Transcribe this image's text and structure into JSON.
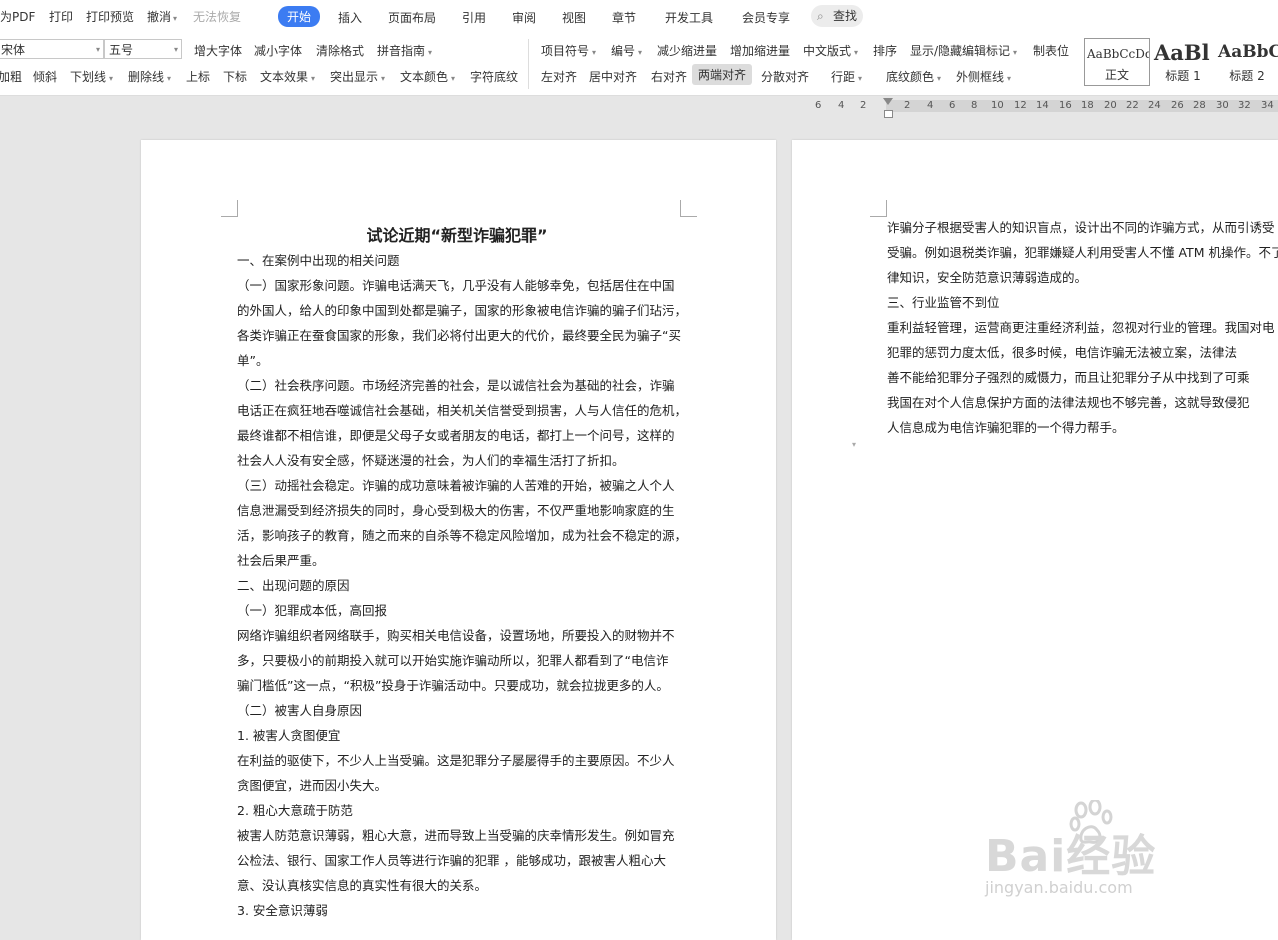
{
  "menubar": {
    "left_items": [
      "为PDF",
      "打印",
      "打印预览",
      "撤消",
      "无法恢复"
    ],
    "tabs": [
      "开始",
      "插入",
      "页面布局",
      "引用",
      "审阅",
      "视图",
      "章节",
      "开发工具",
      "会员专享"
    ],
    "active_tab": "开始",
    "search_label": "查找"
  },
  "toolbar": {
    "font_name": "宋体",
    "font_size": "五号",
    "row1_left": [
      "增大字体",
      "减小字体",
      "清除格式",
      "拼音指南"
    ],
    "row2_left": [
      "加粗",
      "倾斜",
      "下划线",
      "删除线",
      "上标",
      "下标",
      "文本效果",
      "突出显示",
      "文本颜色",
      "字符底纹"
    ],
    "row1_para": [
      "项目符号",
      "编号",
      "减少缩进量",
      "增加缩进量",
      "中文版式",
      "排序",
      "显示/隐藏编辑标记",
      "制表位"
    ],
    "row2_para": [
      "左对齐",
      "居中对齐",
      "右对齐",
      "两端对齐",
      "分散对齐",
      "行距",
      "底纹颜色",
      "外侧框线"
    ],
    "styles": [
      {
        "preview": "AaBbCcDd",
        "name": "正文"
      },
      {
        "preview": "AaBl",
        "name": "标题 1"
      },
      {
        "preview": "AaBbC",
        "name": "标题 2"
      }
    ]
  },
  "ruler": {
    "numbers": [
      "6",
      "4",
      "2",
      "2",
      "4",
      "6",
      "8",
      "10",
      "12",
      "14",
      "16",
      "18",
      "20",
      "22",
      "24",
      "26",
      "28",
      "30",
      "32",
      "34"
    ]
  },
  "document": {
    "title": "试论近期“新型诈骗犯罪”",
    "page1_lines": [
      "一、在案例中出现的相关问题",
      "（一）国家形象问题。诈骗电话满天飞，几乎没有人能够幸免，包括居住在中国",
      "的外国人，给人的印象中国到处都是骗子，国家的形象被电信诈骗的骗子们玷污，",
      "各类诈骗正在蚕食国家的形象，我们必将付出更大的代价，最终要全民为骗子“买",
      "单”。",
      "（二）社会秩序问题。市场经济完善的社会，是以诚信社会为基础的社会，诈骗",
      "电话正在疯狂地吞噬诚信社会基础，相关机关信誉受到损害，人与人信任的危机，",
      "最终谁都不相信谁，即便是父母子女或者朋友的电话，都打上一个问号，这样的",
      "社会人人没有安全感，怀疑迷漫的社会，为人们的幸福生活打了折扣。",
      "（三）动摇社会稳定。诈骗的成功意味着被诈骗的人苦难的开始，被骗之人个人",
      "信息泄漏受到经济损失的同时，身心受到极大的伤害，不仅严重地影响家庭的生",
      "活，影响孩子的教育，随之而来的自杀等不稳定风险增加，成为社会不稳定的源，",
      "社会后果严重。",
      "二、出现问题的原因",
      "（一）犯罪成本低，高回报",
      "网络诈骗组织者网络联手，购买相关电信设备，设置场地，所要投入的财物并不",
      "多，只要极小的前期投入就可以开始实施诈骗动所以，犯罪人都看到了“电信诈",
      "骗门槛低”这一点，“积极”投身于诈骗活动中。只要成功，就会拉拢更多的人。",
      "（二）被害人自身原因",
      "1. 被害人贪图便宜",
      "在利益的驱使下，不少人上当受骗。这是犯罪分子屡屡得手的主要原因。不少人",
      "贪图便宜，进而因小失大。",
      "2. 粗心大意疏于防范",
      "被害人防范意识薄弱，粗心大意，进而导致上当受骗的庆幸情形发生。例如冒充",
      "公检法、银行、国家工作人员等进行诈骗的犯罪 ，能够成功，跟被害人粗心大",
      "意、没认真核实信息的真实性有很大的关系。",
      "3. 安全意识薄弱"
    ],
    "page2_lines": [
      "诈骗分子根据受害人的知识盲点，设计出不同的诈骗方式，从而引诱受",
      "受骗。例如退税类诈骗，犯罪嫌疑人利用受害人不懂 ATM 机操作。不了",
      "律知识，安全防范意识薄弱造成的。",
      "三、行业监管不到位",
      "重利益轻管理，运营商更注重经济利益，忽视对行业的管理。我国对电",
      "犯罪的惩罚力度太低，很多时候，电信诈骗无法被立案，法律法",
      "善不能给犯罪分子强烈的威慑力，而且让犯罪分子从中找到了可乘",
      "我国在对个人信息保护方面的法律法规也不够完善，这就导致侵犯",
      "人信息成为电信诈骗犯罪的一个得力帮手。"
    ]
  },
  "watermark": {
    "brand": "Bai经验",
    "url": "jingyan.baidu.com"
  }
}
